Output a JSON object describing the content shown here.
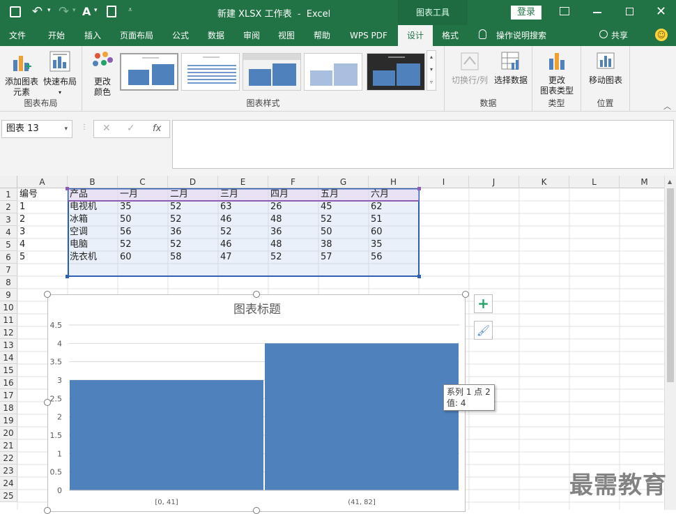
{
  "titlebar": {
    "doc_title": "新建 XLSX 工作表  -  Excel",
    "context_tab": "图表工具",
    "login": "登录"
  },
  "tabs": [
    "文件",
    "开始",
    "插入",
    "页面布局",
    "公式",
    "数据",
    "审阅",
    "视图",
    "帮助",
    "WPS PDF",
    "设计",
    "格式",
    "操作说明搜索"
  ],
  "share": "共享",
  "ribbon": {
    "add_element": "添加图表\n元素",
    "quick_layout": "快速布局",
    "change_color": "更改\n颜色",
    "group_layout": "图表布局",
    "group_styles": "图表样式",
    "switch_rowcol": "切换行/列",
    "select_data": "选择数据",
    "group_data": "数据",
    "change_type": "更改\n图表类型",
    "group_type": "类型",
    "move_chart": "移动图表",
    "group_location": "位置"
  },
  "formula_bar": {
    "name_box": "图表 13",
    "fx": "fx"
  },
  "sheet": {
    "columns": [
      "A",
      "B",
      "C",
      "D",
      "E",
      "F",
      "G",
      "H",
      "I",
      "J",
      "K",
      "L",
      "M"
    ],
    "rows": [
      "1",
      "2",
      "3",
      "4",
      "5",
      "6",
      "7",
      "8",
      "9",
      "10",
      "11",
      "12",
      "13",
      "14",
      "15",
      "16",
      "17",
      "18",
      "19",
      "20",
      "21",
      "22",
      "23",
      "24",
      "25"
    ],
    "data": [
      [
        "编号",
        "产品",
        "一月",
        "二月",
        "三月",
        "四月",
        "五月",
        "六月"
      ],
      [
        "1",
        "电视机",
        "35",
        "52",
        "63",
        "26",
        "45",
        "62"
      ],
      [
        "2",
        "冰箱",
        "50",
        "52",
        "46",
        "48",
        "52",
        "51"
      ],
      [
        "3",
        "空调",
        "56",
        "36",
        "52",
        "36",
        "50",
        "60"
      ],
      [
        "4",
        "电脑",
        "52",
        "52",
        "46",
        "48",
        "38",
        "35"
      ],
      [
        "5",
        "洗衣机",
        "60",
        "58",
        "47",
        "52",
        "57",
        "56"
      ]
    ]
  },
  "chart_data": {
    "type": "bar",
    "title": "图表标题",
    "categories": [
      "[0, 41]",
      "(41, 82]"
    ],
    "values": [
      3,
      4
    ],
    "ylim": [
      0,
      4.5
    ],
    "yticks": [
      "4.5",
      "4",
      "3.5",
      "3",
      "2.5",
      "2",
      "1.5",
      "1",
      "0.5",
      "0"
    ],
    "bar_color": "#4f81bd",
    "grid": true
  },
  "tooltip": {
    "line1": "系列 1 点 2",
    "line2": "值: 4"
  },
  "watermark": "最需教育",
  "colors": {
    "brand": "#217346",
    "selection": "#2f5fb3"
  }
}
